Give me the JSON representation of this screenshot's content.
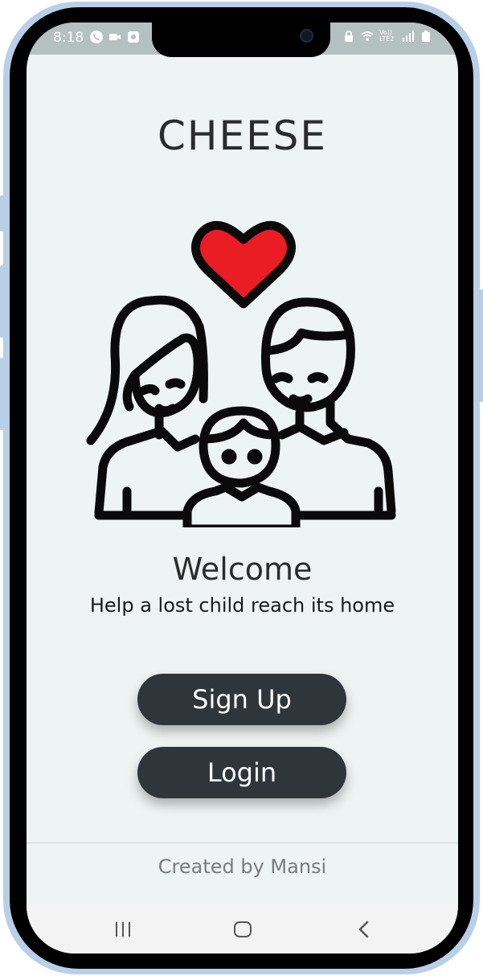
{
  "status_bar": {
    "time": "8:18",
    "network_label": "Vo)) LTE2",
    "left_icons": [
      "phone-call-icon",
      "video-icon",
      "app-icon"
    ],
    "right_icons": [
      "lock-icon",
      "wifi-icon",
      "signal-icon",
      "battery-icon"
    ]
  },
  "app": {
    "title": "CHEESE",
    "welcome": "Welcome",
    "subtitle": "Help a lost child reach its home",
    "illustration_icon": "family-heart-icon",
    "heart_color": "#ea1c24"
  },
  "buttons": {
    "signup_label": "Sign Up",
    "login_label": "Login",
    "button_color": "#2e363b"
  },
  "footer": {
    "text": "Created by Mansi"
  },
  "navigation": {
    "icons": [
      "recent-apps-icon",
      "home-icon",
      "back-icon"
    ]
  },
  "colors": {
    "screen_background": "#edf4f3",
    "frame": "#b9cfe8"
  }
}
